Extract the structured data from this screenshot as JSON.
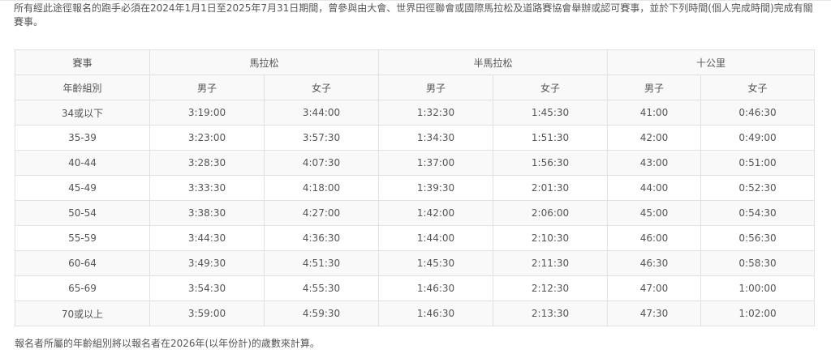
{
  "intro_text": "所有經此途徑報名的跑手必須在2024年1月1日至2025年7月31日期間，曾參與由大會、世界田徑聯會或國際馬拉松及道路賽協會舉辦或認可賽事，並於下列時間(個人完成時間)完成有關賽事。",
  "table": {
    "event_header": "賽事",
    "events": [
      "馬拉松",
      "半馬拉松",
      "十公里"
    ],
    "age_group_header": "年齡組別",
    "male_label": "男子",
    "female_label": "女子",
    "rows": [
      {
        "age": "34或以下",
        "mar_m": "3:19:00",
        "mar_f": "3:44:00",
        "half_m": "1:32:30",
        "half_f": "1:45:30",
        "ten_m": "41:00",
        "ten_f": "0:46:30"
      },
      {
        "age": "35-39",
        "mar_m": "3:23:00",
        "mar_f": "3:57:30",
        "half_m": "1:34:30",
        "half_f": "1:51:30",
        "ten_m": "42:00",
        "ten_f": "0:49:00"
      },
      {
        "age": "40-44",
        "mar_m": "3:28:30",
        "mar_f": "4:07:30",
        "half_m": "1:37:00",
        "half_f": "1:56:30",
        "ten_m": "43:00",
        "ten_f": "0:51:00"
      },
      {
        "age": "45-49",
        "mar_m": "3:33:30",
        "mar_f": "4:18:00",
        "half_m": "1:39:30",
        "half_f": "2:01:30",
        "ten_m": "44:00",
        "ten_f": "0:52:30"
      },
      {
        "age": "50-54",
        "mar_m": "3:38:30",
        "mar_f": "4:27:00",
        "half_m": "1:42:00",
        "half_f": "2:06:00",
        "ten_m": "45:00",
        "ten_f": "0:54:30"
      },
      {
        "age": "55-59",
        "mar_m": "3:44:30",
        "mar_f": "4:36:30",
        "half_m": "1:44:00",
        "half_f": "2:10:30",
        "ten_m": "46:00",
        "ten_f": "0:56:30"
      },
      {
        "age": "60-64",
        "mar_m": "3:49:30",
        "mar_f": "4:51:30",
        "half_m": "1:45:30",
        "half_f": "2:11:30",
        "ten_m": "46:30",
        "ten_f": "0:58:30"
      },
      {
        "age": "65-69",
        "mar_m": "3:54:30",
        "mar_f": "4:55:30",
        "half_m": "1:46:30",
        "half_f": "2:12:30",
        "ten_m": "47:00",
        "ten_f": "1:00:00"
      },
      {
        "age": "70或以上",
        "mar_m": "3:59:00",
        "mar_f": "4:59:30",
        "half_m": "1:46:30",
        "half_f": "2:13:30",
        "ten_m": "47:30",
        "ten_f": "1:02:00"
      }
    ]
  },
  "footnote": "報名者所屬的年齡組別將以報名者在2026年(以年份計)的歲數來計算。"
}
